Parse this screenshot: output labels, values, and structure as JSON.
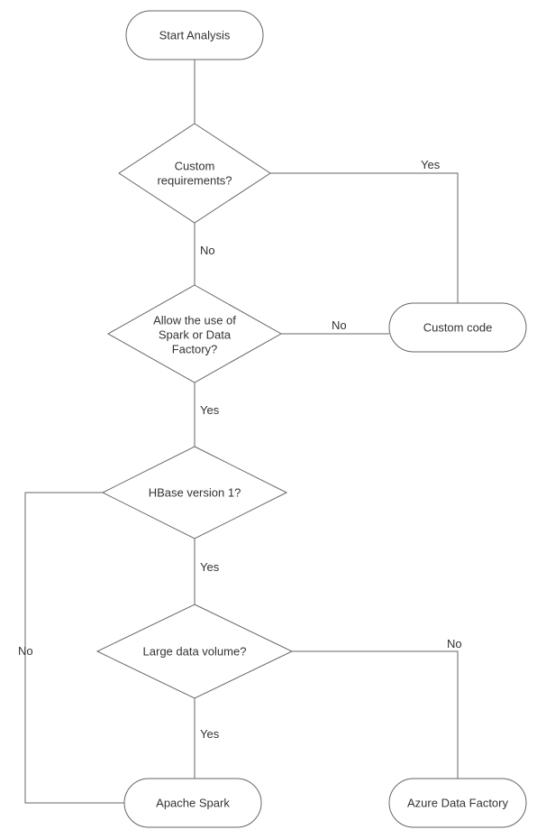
{
  "nodes": {
    "start": "Start Analysis",
    "customReq_l1": "Custom",
    "customReq_l2": "requirements?",
    "allowSpark_l1": "Allow the use of",
    "allowSpark_l2": "Spark or Data",
    "allowSpark_l3": "Factory?",
    "hbase": "HBase version 1?",
    "largeData": "Large data volume?",
    "customCode": "Custom code",
    "apacheSpark": "Apache Spark",
    "azureDF": "Azure Data Factory"
  },
  "edges": {
    "yes": "Yes",
    "no": "No"
  }
}
